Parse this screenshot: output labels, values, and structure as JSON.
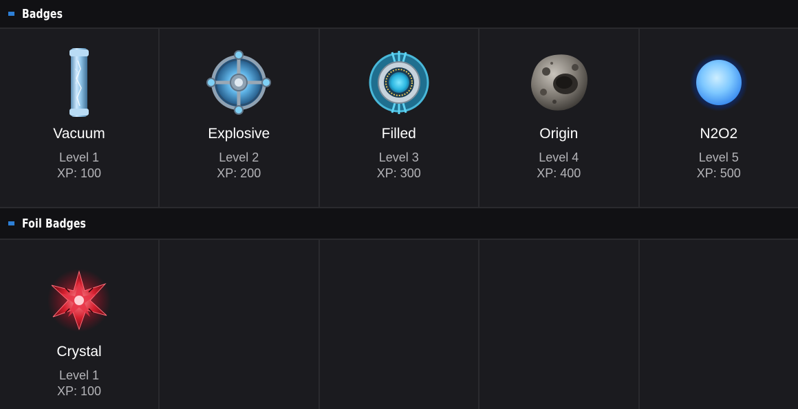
{
  "sections": [
    {
      "title": "Badges",
      "badges": [
        {
          "name": "Vacuum",
          "level": "Level 1",
          "xp": "XP: 100",
          "icon": "crystal-tube-icon"
        },
        {
          "name": "Explosive",
          "level": "Level 2",
          "xp": "XP: 200",
          "icon": "blue-orb-cross-icon"
        },
        {
          "name": "Filled",
          "level": "Level 3",
          "xp": "XP: 300",
          "icon": "cyan-ring-core-icon"
        },
        {
          "name": "Origin",
          "level": "Level 4",
          "xp": "XP: 400",
          "icon": "asteroid-rock-icon"
        },
        {
          "name": "N2O2",
          "level": "Level 5",
          "xp": "XP: 500",
          "icon": "glowing-blue-sphere-icon"
        }
      ]
    },
    {
      "title": "Foil Badges",
      "badges": [
        {
          "name": "Crystal",
          "level": "Level 1",
          "xp": "XP: 100",
          "icon": "red-crystal-star-icon"
        }
      ]
    }
  ],
  "colors": {
    "background": "#1b1b1f",
    "header_background": "#111114",
    "accent_marker": "#2d7fd6",
    "divider": "#2a2a2e",
    "title_text": "#ffffff",
    "sub_text": "#b4b4b8"
  }
}
